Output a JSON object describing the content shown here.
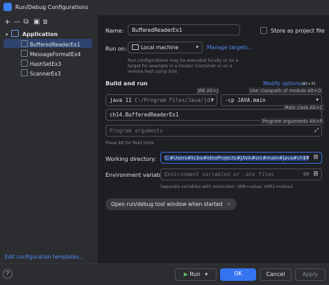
{
  "window": {
    "title": "Run/Debug Configurations"
  },
  "toolbar": {
    "add": "+",
    "remove": "—",
    "copy": "⧉",
    "save": "▣",
    "move": "⧈"
  },
  "tree": {
    "root_label": "Application",
    "items": [
      {
        "label": "BufferedReaderEx1"
      },
      {
        "label": "MessageFormatEx4"
      },
      {
        "label": "HashSetEx3"
      },
      {
        "label": "ScannerEx3"
      }
    ]
  },
  "edit_templates_link": "Edit configuration templates...",
  "form": {
    "name_label": "Name:",
    "name_value": "BufferedReaderEx1",
    "store_project_label": "Store as project file",
    "run_on_label": "Run on:",
    "run_on_value": "Local machine",
    "manage_targets_link": "Manage targets...",
    "run_on_hint": "Run configurations may be executed locally or on a target for example in a Docker Container or on a remote host using SSH.",
    "build_run_title": "Build and run",
    "modify_options_link": "Modify options",
    "modify_options_shortcut": "Alt+M",
    "jre_hint": "JRE Alt+J",
    "classpath_hint": "Use classpath of module Alt+O",
    "jdk_value_bold": "java 11",
    "jdk_value_path": "C:/Program Files/Java/jdi",
    "classpath_value": "-cp JAVA.main",
    "main_class_hint": "Main class Alt+C",
    "main_class_value": "ch14.BufferedReaderEx1",
    "program_args_hint": "Program arguments Alt+R",
    "program_args_placeholder": "Program arguments",
    "field_hints": "Press Alt for field hints",
    "working_dir_label": "Working directory:",
    "working_dir_value": "C:#Users#kcba#IdeaProjects#JAVA#src#main#java#ch14",
    "env_label": "Environment variables:",
    "env_placeholder": "Environment variables or .env files",
    "env_hint": "Separate variables with semicolon: VAR=value; VAR1=value1",
    "chip_label": "Open run/debug tool window when started"
  },
  "footer": {
    "run": "Run",
    "ok": "OK",
    "cancel": "Cancel",
    "apply": "Apply"
  }
}
